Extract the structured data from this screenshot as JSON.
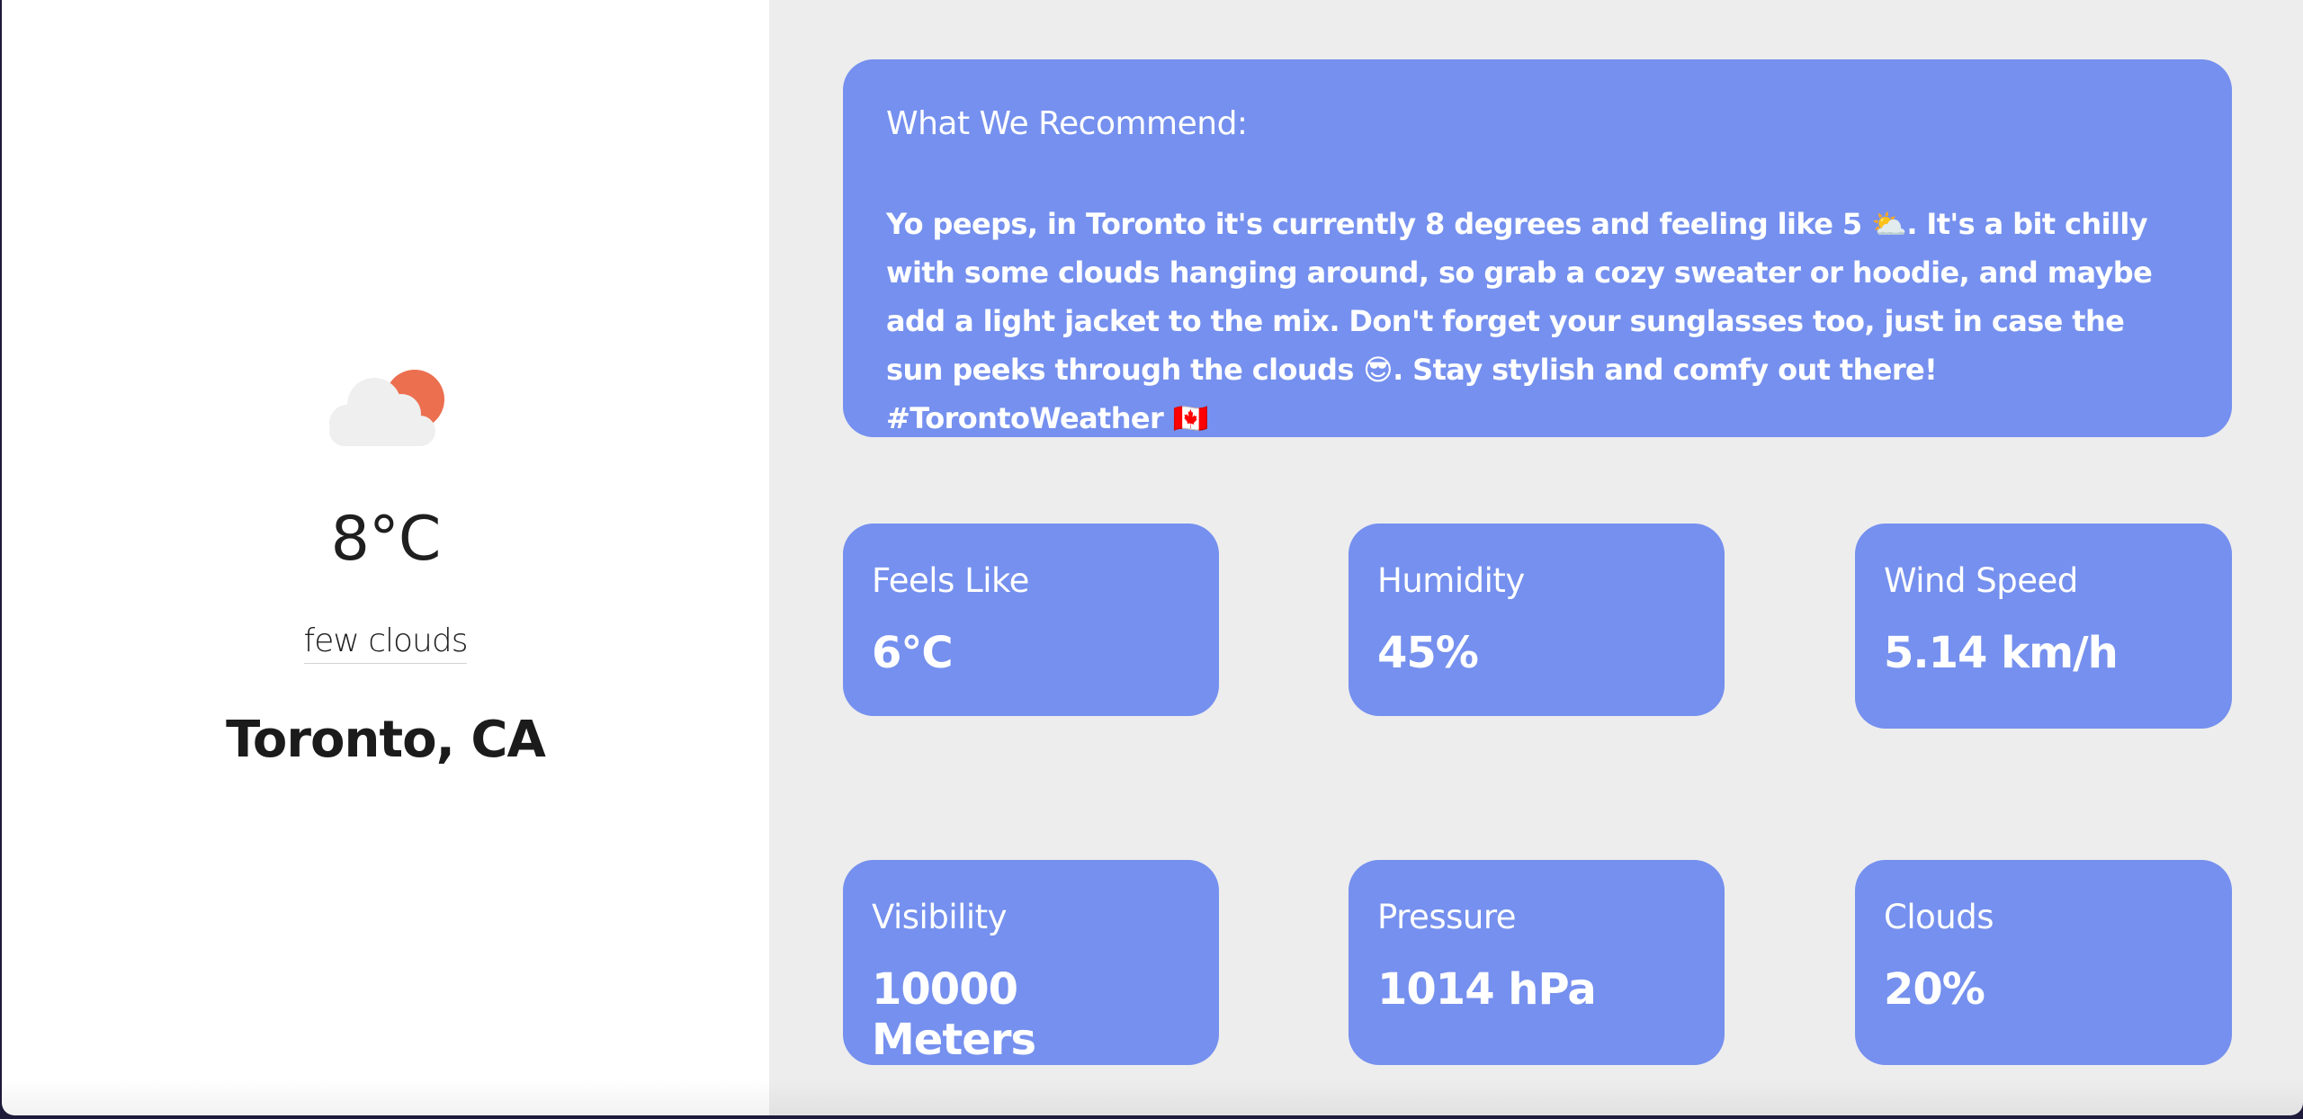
{
  "current": {
    "icon": "few-clouds-icon",
    "temperature": "8°C",
    "description": "few clouds",
    "location": "Toronto, CA"
  },
  "recommendation": {
    "title": "What We Recommend:",
    "text": "Yo peeps, in Toronto it's currently 8 degrees and feeling like 5 ⛅. It's a bit chilly with some clouds hanging around, so grab a cozy sweater or hoodie, and maybe add a light jacket to the mix. Don't forget your sunglasses too, just in case the sun peeks through the clouds 😎. Stay stylish and comfy out there! #TorontoWeather 🇨🇦"
  },
  "stats": [
    {
      "label": "Feels Like",
      "value": "6°C"
    },
    {
      "label": "Humidity",
      "value": "45%"
    },
    {
      "label": "Wind Speed",
      "value": "5.14 km/h"
    },
    {
      "label": "Visibility",
      "value": "10000 Meters"
    },
    {
      "label": "Pressure",
      "value": "1014 hPa"
    },
    {
      "label": "Clouds",
      "value": "20%"
    }
  ],
  "colors": {
    "card": "#7590ee",
    "panel_bg": "#ededee",
    "sun": "#ec6f50",
    "cloud": "#efefef"
  }
}
